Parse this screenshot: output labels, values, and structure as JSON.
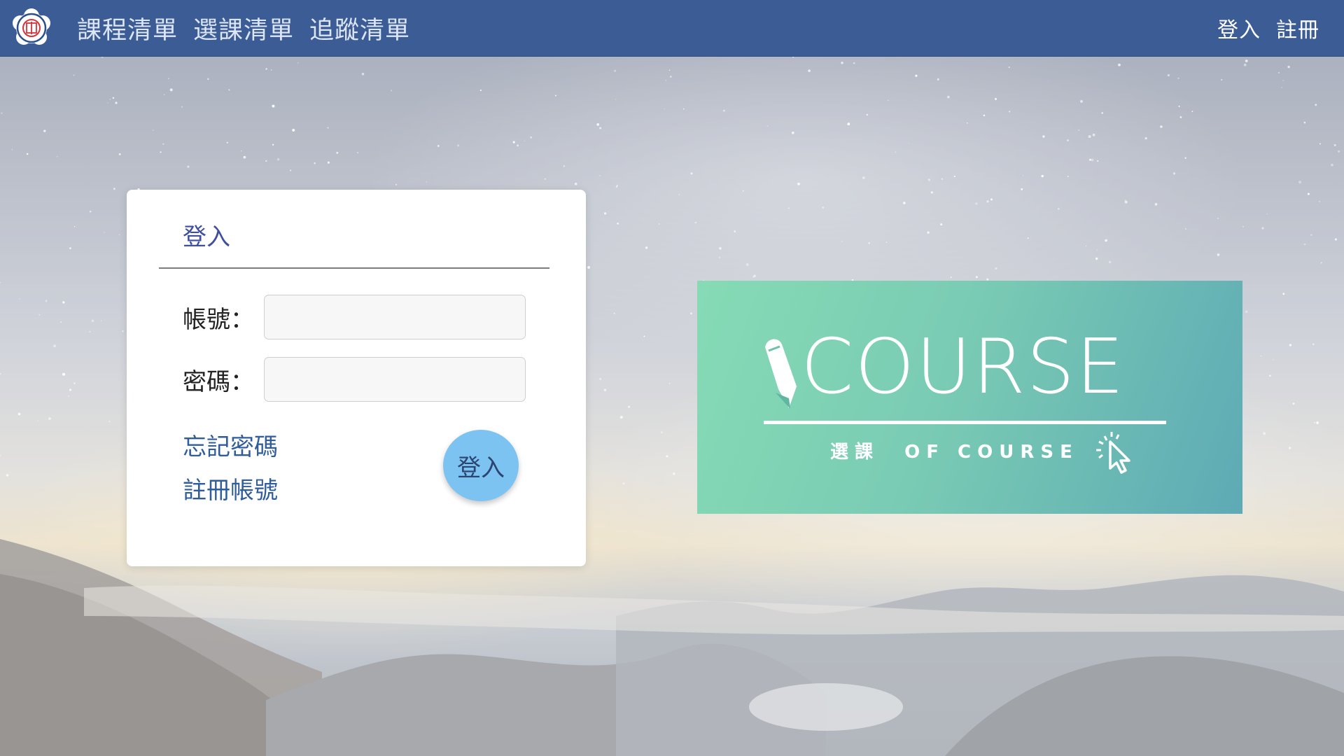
{
  "nav": {
    "logo_icon": "school-seal-icon",
    "links": [
      "課程清單",
      "選課清單",
      "追蹤清單"
    ],
    "login": "登入",
    "register": "註冊",
    "bar_color": "#3b5c94"
  },
  "login_card": {
    "title": "登入",
    "account_label": "帳號：",
    "account_value": "",
    "password_label": "密碼：",
    "password_value": "",
    "forgot_password": "忘記密碼",
    "register_account": "註冊帳號",
    "submit": "登入",
    "submit_color": "#7cc3f1"
  },
  "banner": {
    "title": "COURSE",
    "subtitle_zh": "選課",
    "subtitle_en": "OF COURSE",
    "pencil_icon": "pencil-icon",
    "cursor_icon": "cursor-click-icon",
    "colors": [
      "#86dbb5",
      "#5eaab5"
    ]
  },
  "background": {
    "description_icon": "starry-mountain-background"
  }
}
